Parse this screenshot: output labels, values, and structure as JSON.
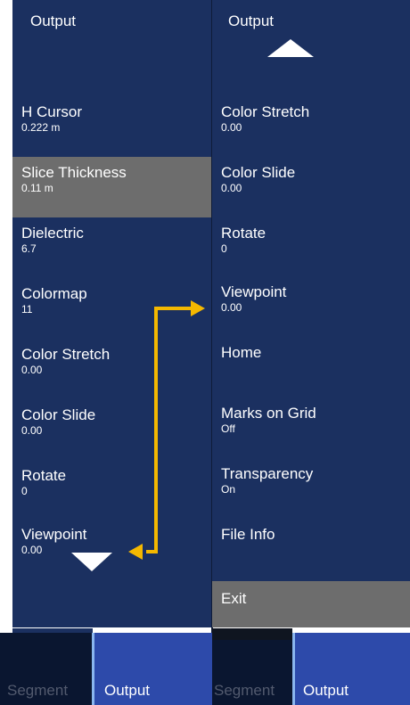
{
  "left_panel": {
    "title": "Output",
    "items": [
      {
        "label": "H Cursor",
        "value": "0.222 m"
      },
      {
        "label": "Slice Thickness",
        "value": "0.11 m",
        "selected": true
      },
      {
        "label": "Dielectric",
        "value": "6.7"
      },
      {
        "label": "Colormap",
        "value": "11"
      },
      {
        "label": "Color Stretch",
        "value": "0.00"
      },
      {
        "label": "Color Slide",
        "value": "0.00"
      },
      {
        "label": "Rotate",
        "value": "0"
      },
      {
        "label": "Viewpoint",
        "value": "0.00"
      }
    ]
  },
  "right_panel": {
    "title": "Output",
    "items": [
      {
        "label": "Color Stretch",
        "value": "0.00"
      },
      {
        "label": "Color Slide",
        "value": "0.00"
      },
      {
        "label": "Rotate",
        "value": "0"
      },
      {
        "label": "Viewpoint",
        "value": "0.00"
      },
      {
        "label": "Home",
        "value": ""
      },
      {
        "label": "Marks on Grid",
        "value": "Off"
      },
      {
        "label": "Transparency",
        "value": "On"
      },
      {
        "label": "File Info",
        "value": ""
      }
    ],
    "exit_label": "Exit"
  },
  "tabs": {
    "left": {
      "inactive": "Segment",
      "active": "Output"
    },
    "right": {
      "inactive": "Segment",
      "active": "Output"
    }
  },
  "colors": {
    "panel_bg": "#1b3060",
    "selected_bg": "#6d6d6d",
    "active_tab_bg": "#2d4aaa",
    "connector_arrow": "#f5b800"
  },
  "icons": {
    "scroll_up": "triangle-up-icon",
    "scroll_down": "triangle-down-icon",
    "connector": "double-headed-bracket-arrow"
  }
}
